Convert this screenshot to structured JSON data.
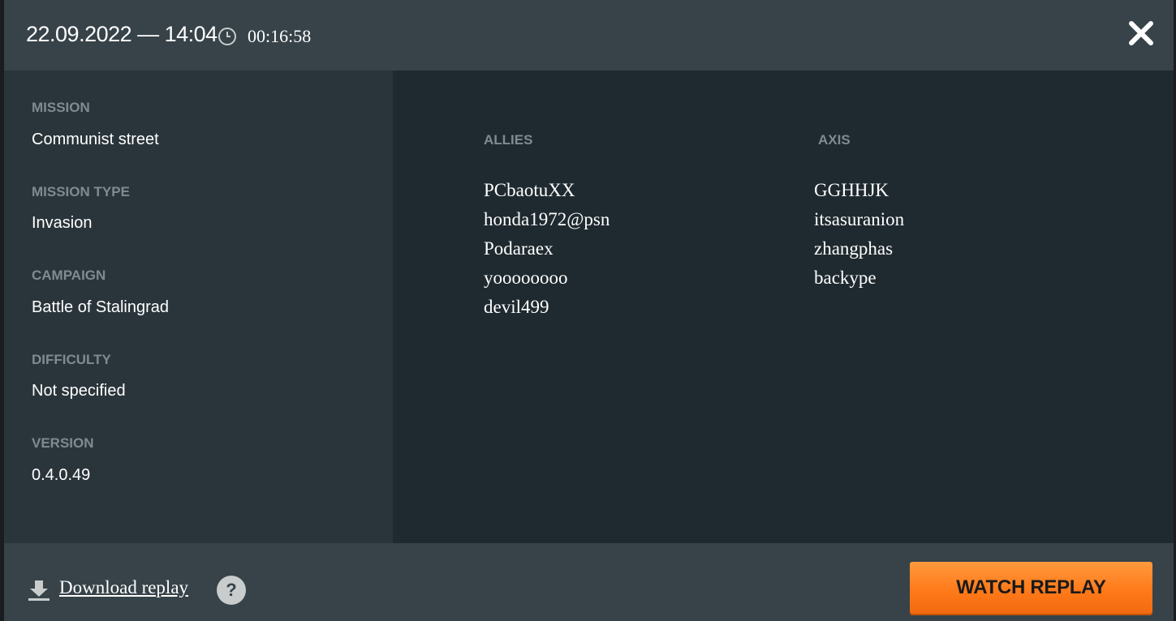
{
  "header": {
    "datetime": "22.09.2022 — 14:04",
    "duration": "00:16:58"
  },
  "info": {
    "mission_label": "MISSION",
    "mission_value": "Communist street",
    "mission_type_label": "MISSION TYPE",
    "mission_type_value": "Invasion",
    "campaign_label": "CAMPAIGN",
    "campaign_value": "Battle of Stalingrad",
    "difficulty_label": "DIFFICULTY",
    "difficulty_value": "Not specified",
    "version_label": "VERSION",
    "version_value": "0.4.0.49"
  },
  "teams": {
    "allies_label": "ALLIES",
    "allies": [
      "PCbaotuXX",
      "honda1972@psn",
      "Podaraex",
      "yoooooooo",
      "devil499"
    ],
    "axis_label": "AXIS",
    "axis": [
      "GGHHJK",
      "itsasuranion",
      "zhangphas",
      "backype"
    ]
  },
  "footer": {
    "download_label": "Download replay",
    "help_label": "?",
    "watch_label": "WATCH REPLAY"
  },
  "colors": {
    "accent_orange": "#ff7a1a",
    "header_bg": "#374349",
    "panel_bg": "#1f2a30",
    "label_gray": "#7e8b91"
  }
}
